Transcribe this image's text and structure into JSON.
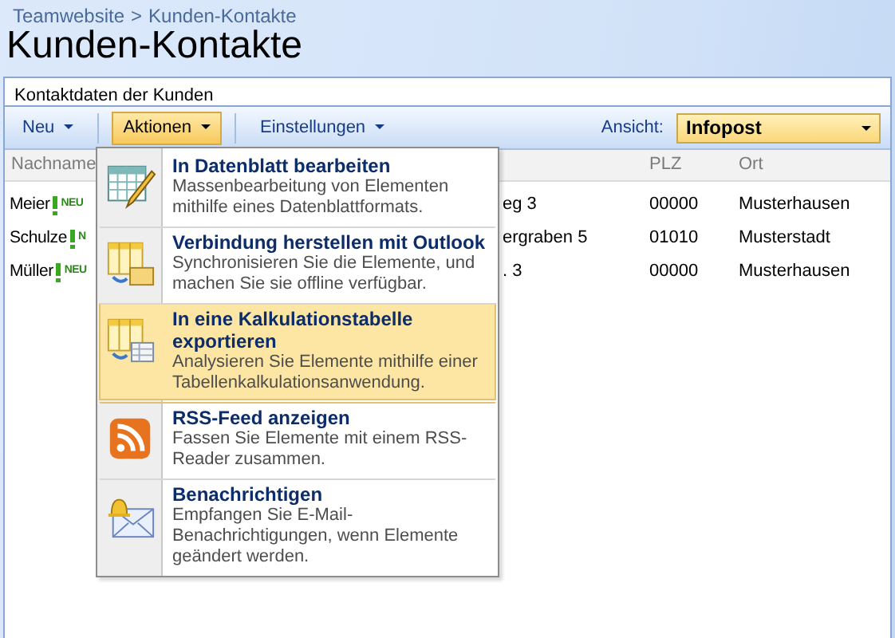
{
  "breadcrumb": {
    "items": [
      "Teamwebsite",
      "Kunden-Kontakte"
    ],
    "separator": ">"
  },
  "title": "Kunden-Kontakte",
  "description": "Kontaktdaten der Kunden",
  "toolbar": {
    "buttons": [
      {
        "label": "Neu",
        "selected": false
      },
      {
        "label": "Aktionen",
        "selected": true
      },
      {
        "label": "Einstellungen",
        "selected": false
      }
    ],
    "view_label": "Ansicht:",
    "view_value": "Infopost"
  },
  "table": {
    "columns": [
      "Nachname",
      "PLZ",
      "Ort"
    ],
    "rows": [
      {
        "name": "Meier",
        "badge": "NEU",
        "column_2": "eg 3",
        "plz": "00000",
        "ort": "Musterhausen"
      },
      {
        "name": "Schulze",
        "badge": "N",
        "column_2": "ergraben 5",
        "plz": "01010",
        "ort": "Musterstadt"
      },
      {
        "name": "Müller",
        "badge": "NEU",
        "column_2": ". 3",
        "plz": "00000",
        "ort": "Musterhausen"
      }
    ]
  },
  "menu": {
    "items": [
      {
        "kind": "datasheet",
        "title": "In Datenblatt bearbeiten",
        "description": "Massenbearbeitung von Elementen mithilfe eines Datenblattformats.",
        "selected": false
      },
      {
        "kind": "outlook",
        "title": "Verbindung herstellen mit Outlook",
        "description": "Synchronisieren Sie die Elemente, und machen Sie sie offline verfügbar.",
        "selected": false
      },
      {
        "kind": "spreadsheet",
        "title": "In eine Kalkulationstabelle exportieren",
        "description": "Analysieren Sie Elemente mithilfe einer Tabellenkalkulationsanwendung.",
        "selected": true
      },
      {
        "kind": "rss",
        "title": "RSS-Feed anzeigen",
        "description": "Fassen Sie Elemente mit einem RSS-Reader zusammen.",
        "selected": false
      },
      {
        "kind": "alert",
        "title": "Benachrichtigen",
        "description": "Empfangen Sie E-Mail-Benachrichtigungen, wenn Elemente geändert werden.",
        "selected": false
      }
    ]
  }
}
